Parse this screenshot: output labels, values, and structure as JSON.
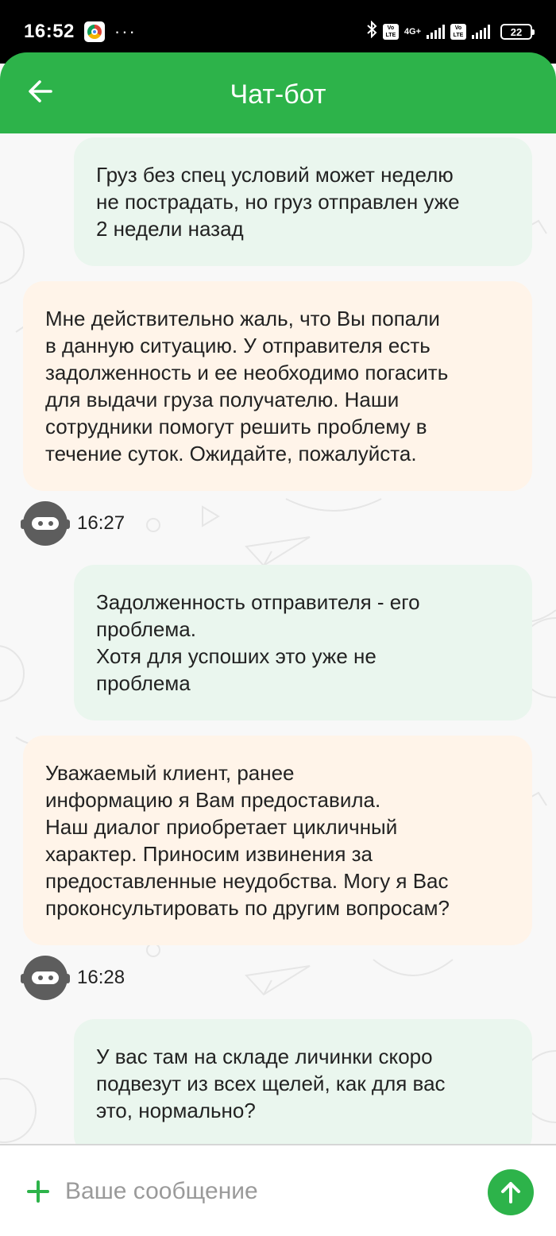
{
  "status_bar": {
    "time": "16:52",
    "overflow_dots": "···",
    "network_type": "4G+",
    "volte_label_1": "Vo LTE",
    "volte_label_2": "Vo LTE",
    "battery": "22"
  },
  "header": {
    "title": "Чат-бот",
    "back_icon": "arrow-left-icon"
  },
  "messages": [
    {
      "sender": "user",
      "text": "Груз без спец условий может неделю\nне пострадать, но груз отправлен уже\n2 недели назад"
    },
    {
      "sender": "bot",
      "text": "Мне действительно жаль, что Вы попали\nв данную ситуацию. У отправителя есть\nзадолженность и ее необходимо погасить\nдля выдачи груза получателю. Наши\nсотрудники помогут решить проблему в\nтечение суток. Ожидайте, пожалуйста.",
      "time": "16:27"
    },
    {
      "sender": "user",
      "text": "Задолженность отправителя - его\nпроблема.\nХотя для успоших это уже не\nпроблема"
    },
    {
      "sender": "bot",
      "text": "Уважаемый клиент, ранее\nинформацию я Вам предоставила.\nНаш диалог приобретает цикличный\nхарактер. Приносим извинения за\nпредоставленные неудобства. Могу я Вас\nпроконсультировать по другим вопросам?",
      "time": "16:28"
    },
    {
      "sender": "user",
      "text": "У вас там на складе личинки скоро\nподвезут из всех щелей, как для вас\nэто, нормально?"
    }
  ],
  "input": {
    "placeholder": "Ваше сообщение",
    "value": "",
    "add_icon": "plus-icon",
    "send_icon": "arrow-up-icon"
  },
  "colors": {
    "accent": "#2db34a",
    "user_bubble": "#eaf6ee",
    "bot_bubble": "#fff4e9",
    "avatar": "#5d5d5d"
  }
}
